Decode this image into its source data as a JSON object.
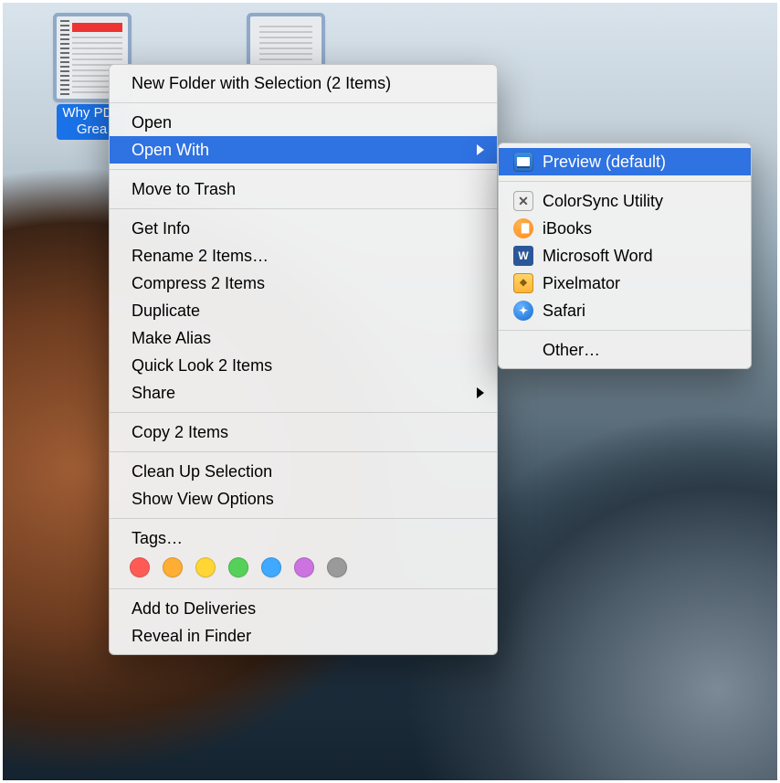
{
  "desktop": {
    "icons": [
      {
        "filename_line1": "Why PDF",
        "filename_line2": "Grea",
        "variant": "red"
      },
      {
        "filename_line1": "",
        "filename_line2": "",
        "variant": "plain"
      }
    ]
  },
  "context_menu": {
    "items": [
      {
        "label": "New Folder with Selection (2 Items)",
        "submenu": false
      },
      {
        "sep": true
      },
      {
        "label": "Open",
        "submenu": false
      },
      {
        "label": "Open With",
        "submenu": true,
        "highlighted": true
      },
      {
        "sep": true
      },
      {
        "label": "Move to Trash",
        "submenu": false
      },
      {
        "sep": true
      },
      {
        "label": "Get Info",
        "submenu": false
      },
      {
        "label": "Rename 2 Items…",
        "submenu": false
      },
      {
        "label": "Compress 2 Items",
        "submenu": false
      },
      {
        "label": "Duplicate",
        "submenu": false
      },
      {
        "label": "Make Alias",
        "submenu": false
      },
      {
        "label": "Quick Look 2 Items",
        "submenu": false
      },
      {
        "label": "Share",
        "submenu": true
      },
      {
        "sep": true
      },
      {
        "label": "Copy 2 Items",
        "submenu": false
      },
      {
        "sep": true
      },
      {
        "label": "Clean Up Selection",
        "submenu": false
      },
      {
        "label": "Show View Options",
        "submenu": false
      },
      {
        "sep": true
      },
      {
        "label": "Tags…",
        "submenu": false
      },
      {
        "tagrow": true
      },
      {
        "sep": true
      },
      {
        "label": "Add to Deliveries",
        "submenu": false
      },
      {
        "label": "Reveal in Finder",
        "submenu": false
      }
    ],
    "tag_colors": [
      "#ff5b56",
      "#ffae33",
      "#ffd633",
      "#55d159",
      "#3ea9ff",
      "#cc73e1",
      "#9a9a9a"
    ]
  },
  "open_with_submenu": {
    "items": [
      {
        "label": "Preview (default)",
        "icon": "preview",
        "highlighted": true
      },
      {
        "sep": true
      },
      {
        "label": "ColorSync Utility",
        "icon": "colorsync"
      },
      {
        "label": "iBooks",
        "icon": "ibooks"
      },
      {
        "label": "Microsoft Word",
        "icon": "word"
      },
      {
        "label": "Pixelmator",
        "icon": "pixelmator"
      },
      {
        "label": "Safari",
        "icon": "safari"
      },
      {
        "sep": true
      },
      {
        "label": "Other…",
        "icon": ""
      }
    ]
  }
}
